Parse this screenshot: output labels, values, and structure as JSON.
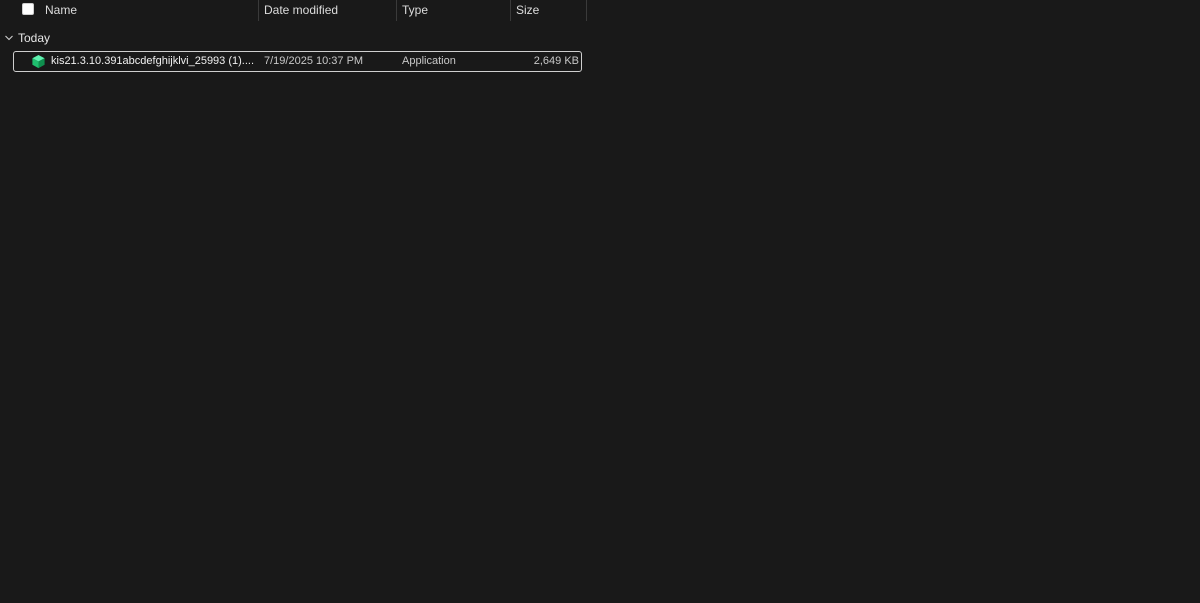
{
  "columns": {
    "name": "Name",
    "date_modified": "Date modified",
    "type": "Type",
    "size": "Size"
  },
  "group": {
    "label": "Today",
    "expanded": true,
    "icon": "chevron-down-icon"
  },
  "files": [
    {
      "name": "kis21.3.10.391abcdefghijklvi_25993 (1)....",
      "date_modified": "7/19/2025 10:37 PM",
      "type": "Application",
      "size": "2,649 KB",
      "icon": "application-cube-icon",
      "selected": true
    }
  ],
  "colors": {
    "background": "#191919",
    "text": "#e6e6e6",
    "icon_green": "#2bd98a",
    "selection_border": "#cfcfcf"
  }
}
